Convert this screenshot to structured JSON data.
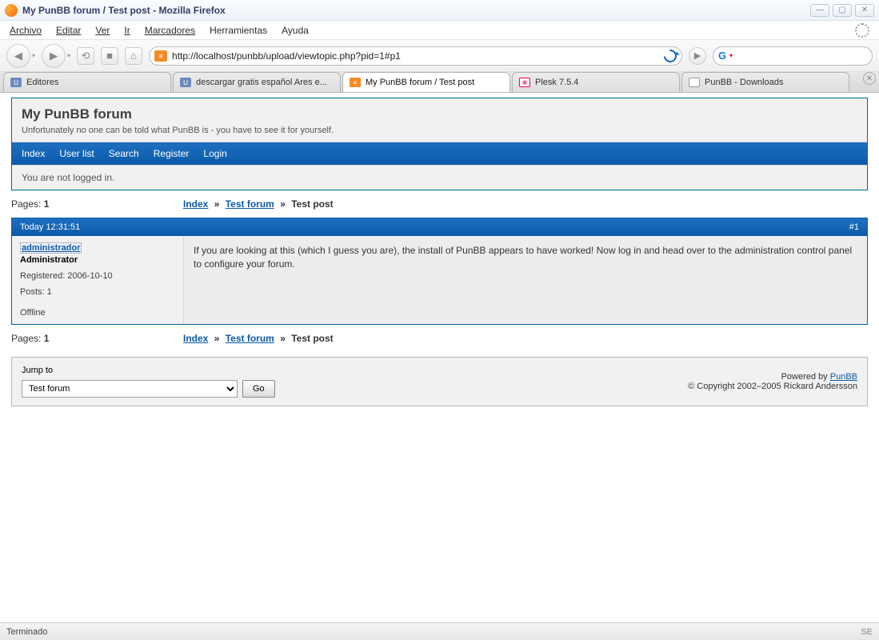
{
  "window": {
    "title": "My PunBB forum / Test post - Mozilla Firefox"
  },
  "menu": {
    "archivo": "Archivo",
    "editar": "Editar",
    "ver": "Ver",
    "ir": "Ir",
    "marcadores": "Marcadores",
    "herramientas": "Herramientas",
    "ayuda": "Ayuda"
  },
  "toolbar": {
    "url": "http://localhost/punbb/upload/viewtopic.php?pid=1#p1",
    "search_engine": "G"
  },
  "tabs": [
    {
      "label": "Editores",
      "icon": "utd"
    },
    {
      "label": "descargar gratis español Ares e...",
      "icon": "utd"
    },
    {
      "label": "My PunBB forum / Test post",
      "icon": "orange",
      "active": true
    },
    {
      "label": "Plesk 7.5.4",
      "icon": "gear"
    },
    {
      "label": "PunBB - Downloads",
      "icon": "dl"
    }
  ],
  "forum": {
    "title": "My PunBB forum",
    "desc": "Unfortunately no one can be told what PunBB is - you have to see it for yourself.",
    "nav": {
      "index": "Index",
      "userlist": "User list",
      "search": "Search",
      "register": "Register",
      "login": "Login"
    },
    "status": "You are not logged in."
  },
  "pagination": {
    "label": "Pages:",
    "page": "1"
  },
  "breadcrumbs": {
    "index": "Index",
    "forum": "Test forum",
    "topic": "Test post",
    "sep": "»"
  },
  "post": {
    "timestamp": "Today 12:31:51",
    "number": "#1",
    "poster": "administrador",
    "role": "Administrator",
    "registered_label": "Registered:",
    "registered": "2006-10-10",
    "posts_label": "Posts:",
    "posts": "1",
    "online_status": "Offline",
    "message": "If you are looking at this (which I guess you are), the install of PunBB appears to have worked! Now log in and head over to the administration control panel to configure your forum."
  },
  "jumpbox": {
    "label": "Jump to",
    "selected": "Test forum",
    "go": "Go"
  },
  "footer": {
    "powered_label": "Powered by",
    "powered_link": "PunBB",
    "copyright": "© Copyright 2002–2005 Rickard Andersson"
  },
  "statusbar": {
    "text": "Terminado",
    "badge": "SE"
  }
}
